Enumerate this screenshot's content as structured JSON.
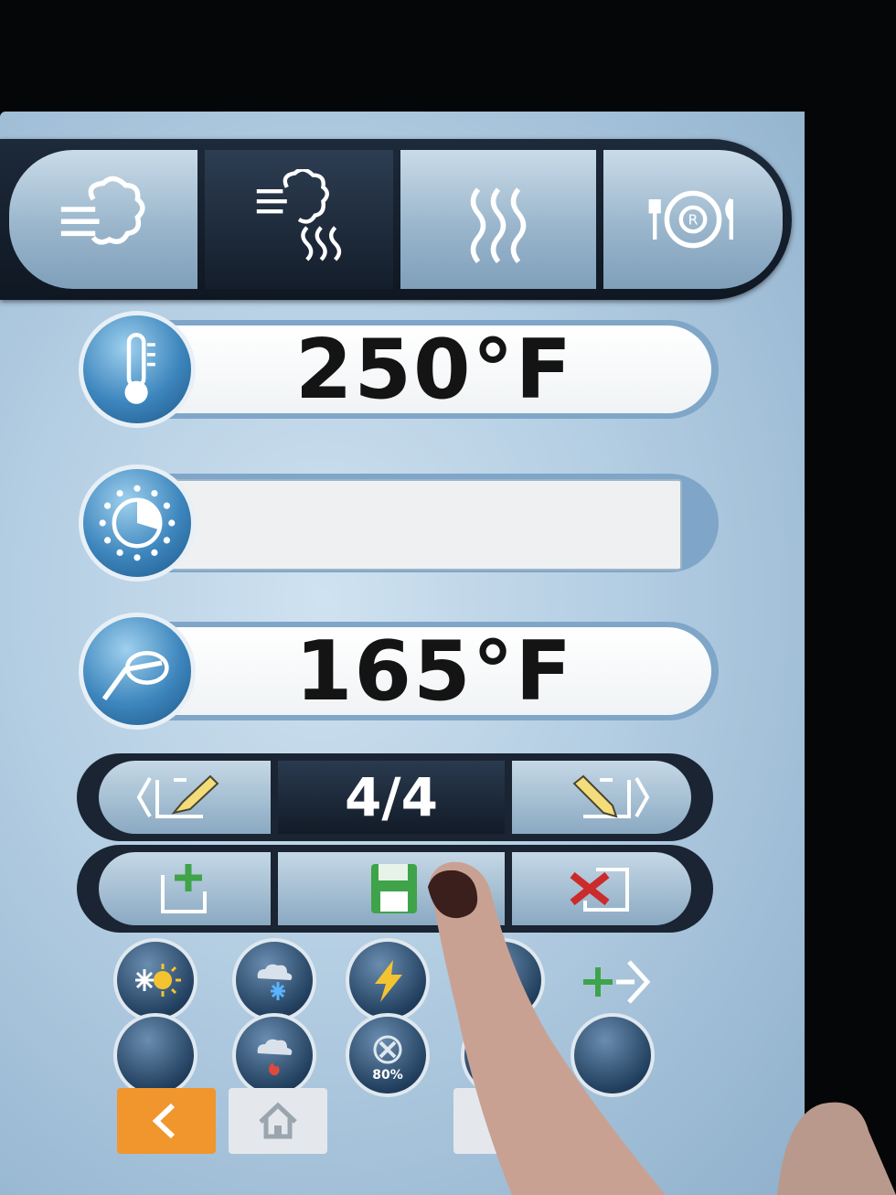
{
  "modes": [
    {
      "name": "steam",
      "icon": "steam-icon",
      "active": false
    },
    {
      "name": "combination",
      "icon": "steam-heat-icon",
      "active": true
    },
    {
      "name": "hot-air",
      "icon": "heat-waves-icon",
      "active": false
    },
    {
      "name": "regeneration",
      "icon": "plate-icon",
      "active": false
    }
  ],
  "params": {
    "temperature": "250°F",
    "timer": "",
    "core_temperature": "165°F"
  },
  "steps": {
    "counter": "4/4"
  },
  "options": {
    "fan_speed_percent": "80%",
    "partial_label": "1"
  },
  "colors": {
    "accent_orange": "#f0962c",
    "save_green": "#3fa34a",
    "delete_red": "#cc2b2b",
    "add_green": "#3fa34a"
  }
}
